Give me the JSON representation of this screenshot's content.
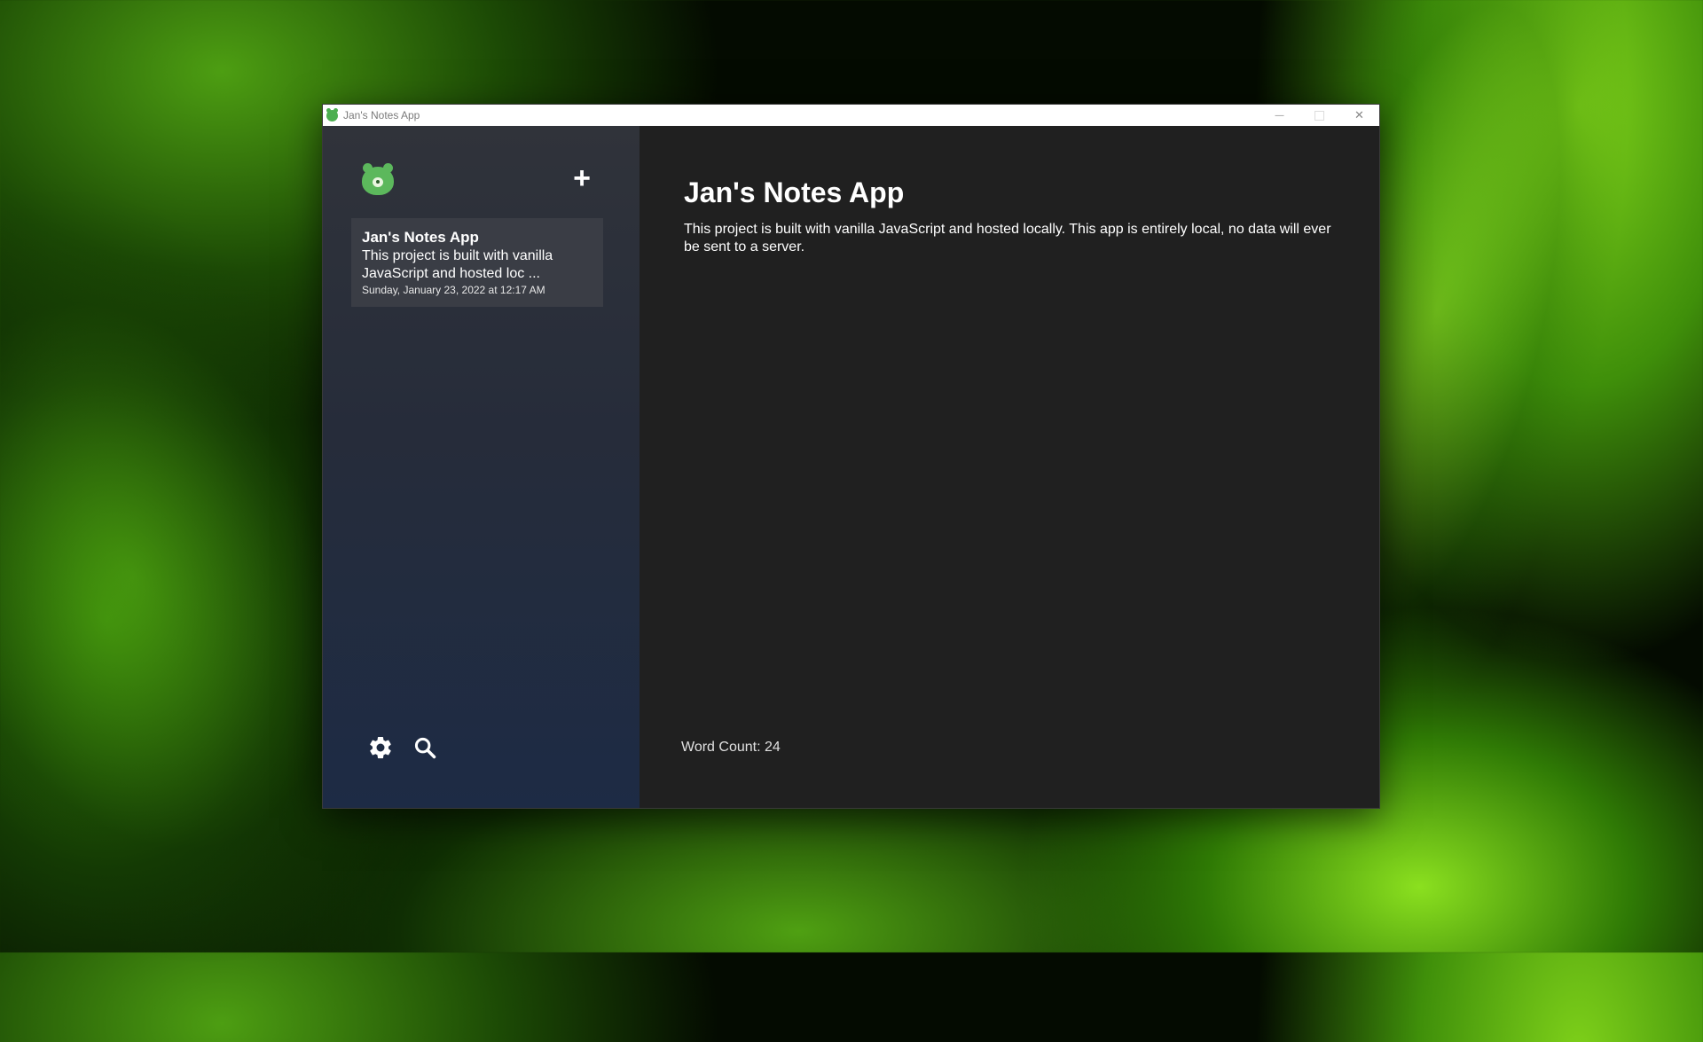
{
  "window": {
    "title": "Jan's Notes App",
    "controls": {
      "minimize": "—",
      "close": "✕"
    }
  },
  "sidebar": {
    "add_label": "+",
    "notes": [
      {
        "title": "Jan's Notes App",
        "preview": "This project is built with vanilla JavaScript and hosted loc ...",
        "date": "Sunday, January 23, 2022 at 12:17 AM"
      }
    ],
    "icons": [
      "settings-icon",
      "search-icon"
    ]
  },
  "main": {
    "title": "Jan's Notes App",
    "body": "This project is built with vanilla JavaScript and hosted locally. This app is entirely local, no data will ever be sent to a server.",
    "word_count_label": "Word Count: ",
    "word_count": "24"
  },
  "colors": {
    "accent": "#5cb85c",
    "sidebar_top": "#30333a",
    "sidebar_bottom": "#1d2b45",
    "main_bg": "#202020"
  }
}
